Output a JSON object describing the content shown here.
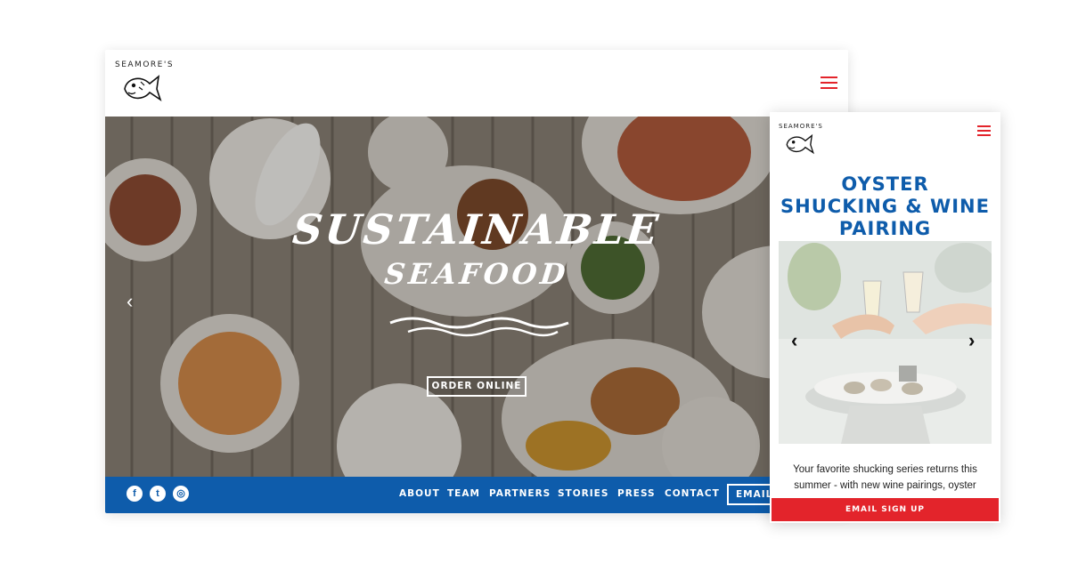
{
  "desktop": {
    "brand": "SEAMORE'S",
    "hero": {
      "title_line1": "SUSTAINABLE",
      "title_line2": "SEAFOOD",
      "cta": "ORDER ONLINE",
      "prev_arrow": "‹"
    },
    "social": [
      {
        "name": "facebook-icon",
        "glyph": "f"
      },
      {
        "name": "twitter-icon",
        "glyph": "t"
      },
      {
        "name": "instagram-icon",
        "glyph": "◎"
      }
    ],
    "nav": [
      "ABOUT",
      "TEAM",
      "PARTNERS",
      "STORIES",
      "PRESS",
      "CONTACT"
    ],
    "email_button": "EMAIL"
  },
  "mobile": {
    "brand": "SEAMORE'S",
    "title_line1": "OYSTER",
    "title_line2": "SHUCKING & WINE",
    "title_line3": "PAIRING",
    "prev_arrow": "‹",
    "next_arrow": "›",
    "description_line1": "Your favorite shucking series returns this",
    "description_line2": "summer - with new wine pairings, oyster",
    "email_signup": "EMAIL SIGN UP"
  },
  "colors": {
    "brand_blue": "#0e5cab",
    "accent_red": "#e3242b"
  }
}
